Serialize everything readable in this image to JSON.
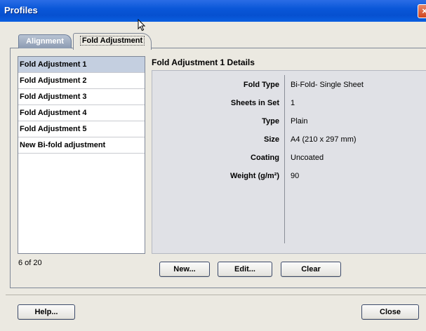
{
  "window": {
    "title": "Profiles",
    "close_glyph": "×"
  },
  "tabs": [
    {
      "label": "Alignment",
      "active": false
    },
    {
      "label": "Fold Adjustment",
      "active": true
    }
  ],
  "list": {
    "items": [
      {
        "label": "Fold Adjustment 1",
        "selected": true
      },
      {
        "label": "Fold Adjustment 2",
        "selected": false
      },
      {
        "label": "Fold Adjustment 3",
        "selected": false
      },
      {
        "label": "Fold Adjustment 4",
        "selected": false
      },
      {
        "label": "Fold Adjustment 5",
        "selected": false
      },
      {
        "label": "New Bi-fold adjustment",
        "selected": false
      }
    ],
    "count": "6 of 20"
  },
  "details": {
    "title": "Fold Adjustment 1 Details",
    "properties": [
      {
        "label": "Fold Type",
        "value": "Bi-Fold- Single Sheet"
      },
      {
        "label": "Sheets in Set",
        "value": "1"
      },
      {
        "label": "Type",
        "value": "Plain"
      },
      {
        "label": "Size",
        "value": "A4 (210 x 297 mm)"
      },
      {
        "label": "Coating",
        "value": "Uncoated"
      },
      {
        "label": "Weight (g/m²)",
        "value": "90"
      }
    ]
  },
  "buttons": {
    "new": "New...",
    "edit": "Edit...",
    "clear": "Clear",
    "help": "Help...",
    "close": "Close"
  },
  "colors": {
    "titlebar": "#0650d0",
    "selected_row": "#c4cfe0",
    "details_bg": "#e0e1e6"
  }
}
